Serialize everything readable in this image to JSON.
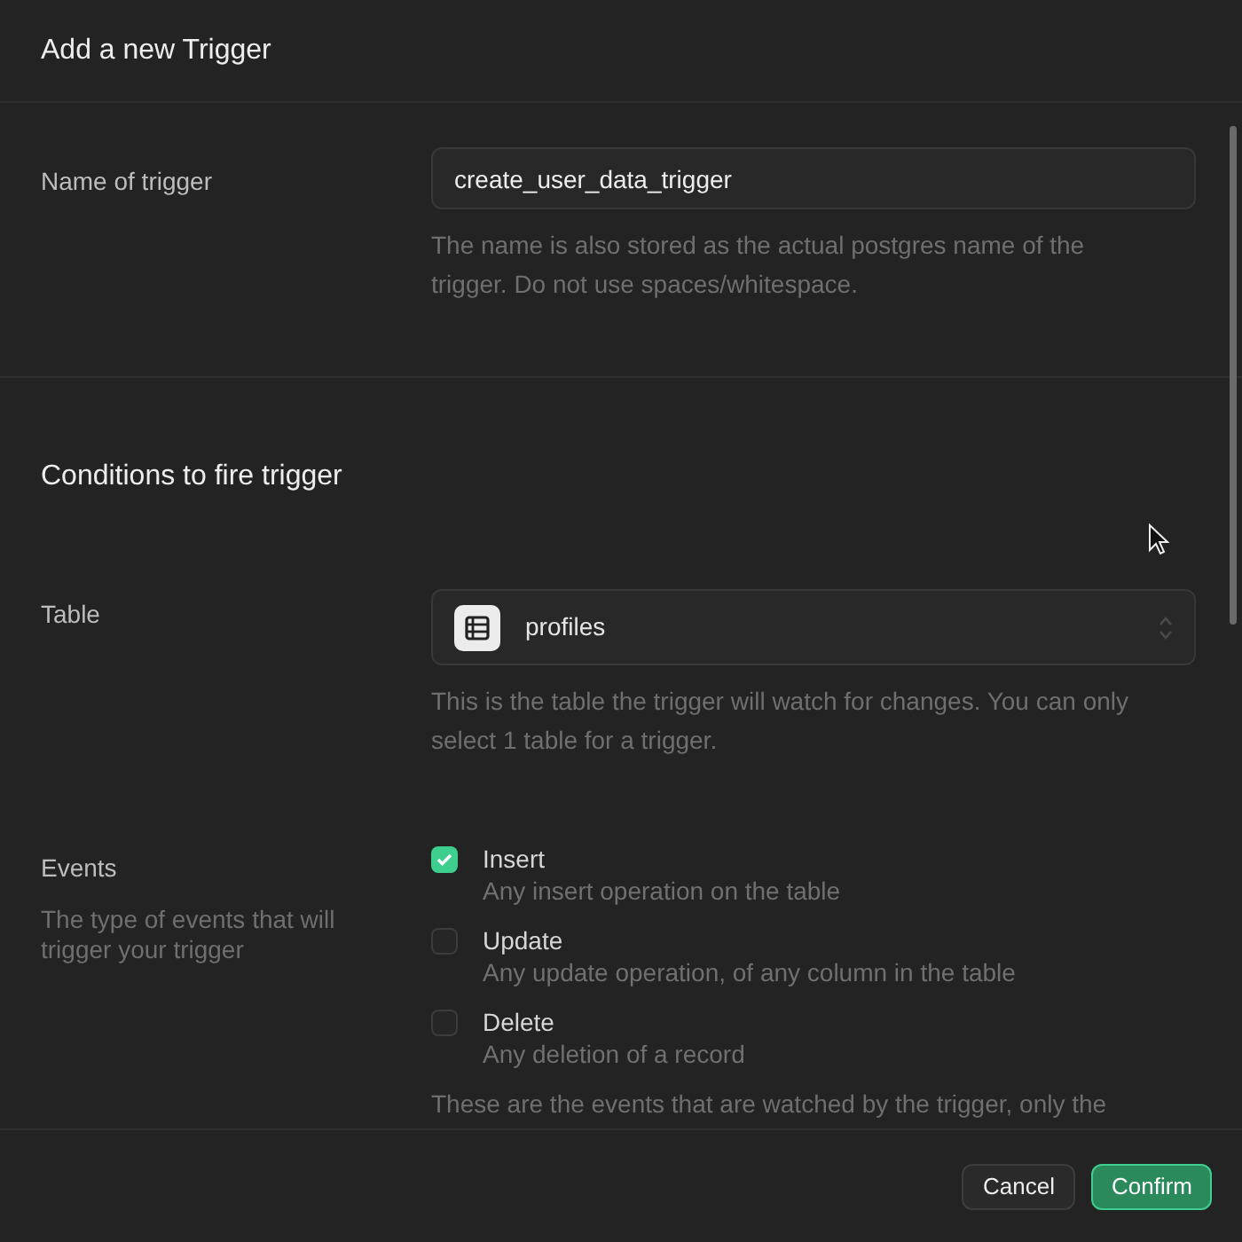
{
  "dialog": {
    "title": "Add a new Trigger"
  },
  "name_section": {
    "label": "Name of trigger",
    "input": {
      "value": "create_user_data_trigger"
    },
    "help": "The name is also stored as the actual postgres name of the trigger. Do not use spaces/whitespace."
  },
  "conditions_section": {
    "heading": "Conditions to fire trigger",
    "table": {
      "label": "Table",
      "select": {
        "value": "profiles"
      },
      "help": "This is the table the trigger will watch for changes. You can only select 1 table for a trigger."
    },
    "events": {
      "label": "Events",
      "description": "The type of events that will trigger your trigger",
      "options": [
        {
          "label": "Insert",
          "description": "Any insert operation on the table",
          "checked": true
        },
        {
          "label": "Update",
          "description": "Any update operation, of any column in the table",
          "checked": false
        },
        {
          "label": "Delete",
          "description": "Any deletion of a record",
          "checked": false
        }
      ],
      "help": "These are the events that are watched by the trigger, only the"
    }
  },
  "footer": {
    "buttons": [
      {
        "label": "Cancel",
        "kind": "secondary"
      },
      {
        "label": "Confirm",
        "kind": "primary"
      }
    ]
  }
}
